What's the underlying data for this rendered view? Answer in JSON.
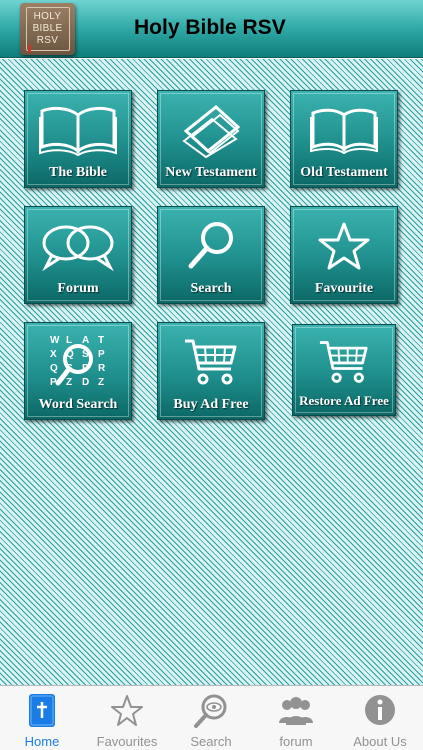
{
  "header": {
    "title": "Holy Bible RSV",
    "logo_lines": [
      "HOLY",
      "BIBLE",
      "RSV"
    ]
  },
  "tiles": [
    {
      "label": "The Bible",
      "icon": "open-book-icon"
    },
    {
      "label": "New Testament",
      "icon": "pages-icon"
    },
    {
      "label": "Old Testament",
      "icon": "open-book-icon"
    },
    {
      "label": "Forum",
      "icon": "speech-bubbles-icon"
    },
    {
      "label": "Search",
      "icon": "magnifier-icon"
    },
    {
      "label": "Favourite",
      "icon": "star-icon"
    },
    {
      "label": "Word Search",
      "icon": "word-search-icon"
    },
    {
      "label": "Buy Ad Free",
      "icon": "shopping-cart-icon"
    },
    {
      "label": "Restore Ad Free",
      "icon": "shopping-cart-icon"
    }
  ],
  "word_grid": [
    "W",
    "L",
    "A",
    "T",
    "X",
    "Q",
    "S",
    "P",
    "Q",
    "S",
    "P",
    "R",
    "P",
    "Z",
    "D",
    "Z"
  ],
  "tabbar": {
    "items": [
      {
        "label": "Home",
        "icon": "bible-book-icon",
        "active": true
      },
      {
        "label": "Favourites",
        "icon": "star-outline-icon",
        "active": false
      },
      {
        "label": "Search",
        "icon": "search-eye-icon",
        "active": false
      },
      {
        "label": "forum",
        "icon": "people-icon",
        "active": false
      },
      {
        "label": "About Us",
        "icon": "info-icon",
        "active": false
      }
    ]
  },
  "colors": {
    "header_top": "#6fd3d1",
    "header_bottom": "#0f7d7b",
    "tile_top": "#3bb3b0",
    "tile_bottom": "#0b6866",
    "background_stripe": "#2e9ea0",
    "tab_active": "#1a7de5",
    "tab_inactive": "#929292"
  }
}
